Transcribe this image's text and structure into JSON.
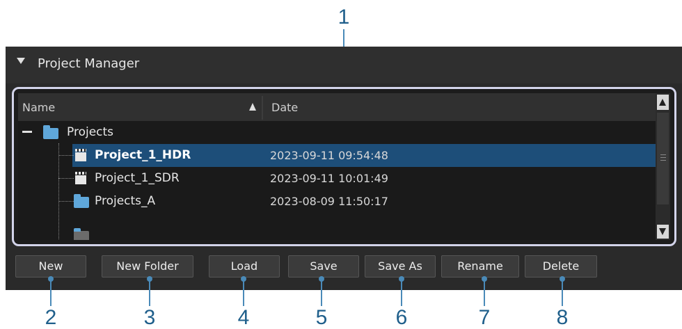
{
  "panel": {
    "title": "Project Manager"
  },
  "columns": {
    "name": "Name",
    "date": "Date"
  },
  "tree": {
    "root": {
      "name": "Projects",
      "icon": "folder-icon"
    },
    "children": [
      {
        "name": "Project_1_HDR",
        "date": "2023-09-11 09:54:48",
        "icon": "clapperboard-icon",
        "selected": true
      },
      {
        "name": "Project_1_SDR",
        "date": "2023-09-11 10:01:49",
        "icon": "clapperboard-icon",
        "selected": false
      },
      {
        "name": "Projects_A",
        "date": "2023-08-09 11:50:17",
        "icon": "folder-icon",
        "selected": false
      }
    ]
  },
  "buttons": {
    "new": "New",
    "new_folder": "New Folder",
    "load": "Load",
    "save": "Save",
    "save_as": "Save As",
    "rename": "Rename",
    "delete": "Delete"
  },
  "callouts": {
    "c1": "1",
    "c2": "2",
    "c3": "3",
    "c4": "4",
    "c5": "5",
    "c6": "6",
    "c7": "7",
    "c8": "8"
  },
  "colors": {
    "selection": "#1d4e79",
    "folder": "#5fa7da",
    "callout": "#1f5f8b"
  }
}
